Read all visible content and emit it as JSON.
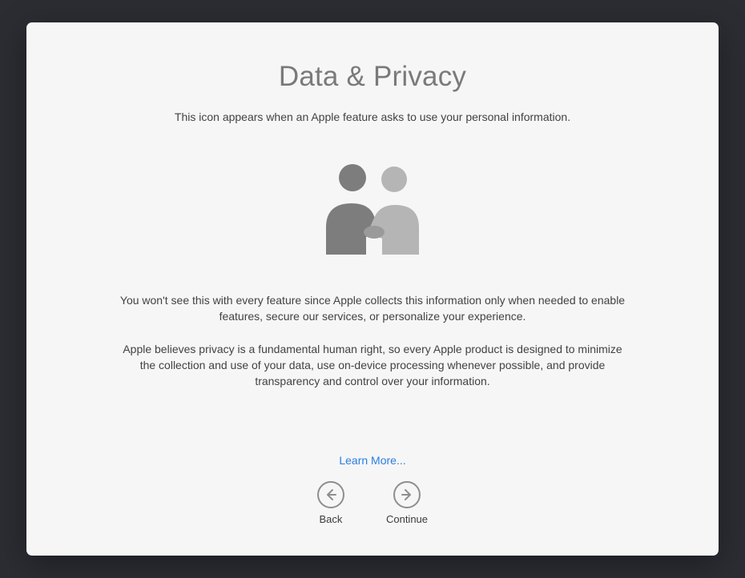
{
  "header": {
    "title": "Data & Privacy",
    "subtitle": "This icon appears when an Apple feature asks to use your personal information."
  },
  "body": {
    "paragraph1": "You won't see this with every feature since Apple collects this information only when needed to enable features, secure our services, or personalize your experience.",
    "paragraph2": "Apple believes privacy is a fundamental human right, so every Apple product is designed to minimize the collection and use of your data, use on-device processing whenever possible, and provide transparency and control over your information."
  },
  "footer": {
    "learn_more": "Learn More...",
    "back_label": "Back",
    "continue_label": "Continue"
  },
  "icons": {
    "privacy": "privacy-handshake-icon",
    "back": "arrow-left-circle-icon",
    "continue": "arrow-right-circle-icon"
  },
  "colors": {
    "accent_link": "#2a7de1",
    "title_gray": "#7a7a7a",
    "text": "#424242",
    "icon_gray": "#8e8e8e",
    "panel_bg": "#f6f6f6",
    "backdrop": "#2b2d33"
  }
}
